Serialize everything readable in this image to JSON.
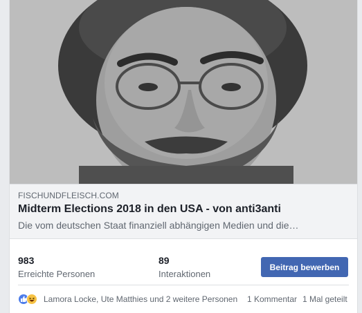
{
  "link": {
    "domain": "FISCHUNDFLEISCH.COM",
    "title": "Midterm Elections 2018 in den USA - von anti3anti",
    "description": "Die vom deutschen Staat finanziell abhängigen Medien und die…"
  },
  "stats": {
    "reached_count": "983",
    "reached_label": "Erreichte Personen",
    "interactions_count": "89",
    "interactions_label": "Interaktionen",
    "boost_button": "Beitrag bewerben"
  },
  "reactions": {
    "icons": [
      "like-icon",
      "haha-icon"
    ],
    "names": "Lamora Locke, Ute Matthies und 2 weitere Personen",
    "comments": "1 Kommentar",
    "shares": "1 Mal geteilt"
  },
  "colors": {
    "accent": "#4267b2",
    "like": "#4d7dea",
    "haha": "#f6c244"
  }
}
